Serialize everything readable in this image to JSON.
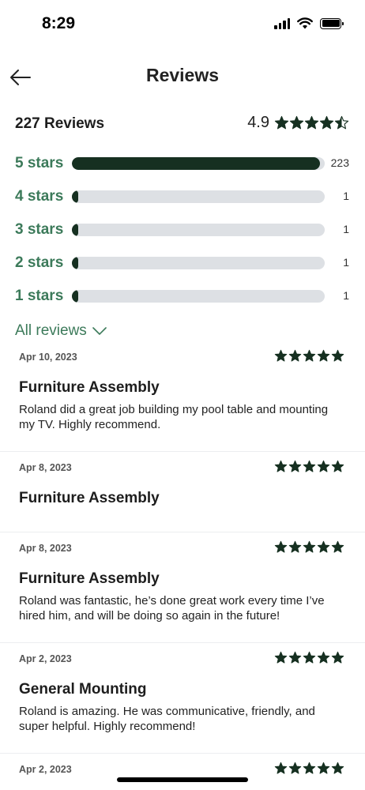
{
  "status": {
    "time": "8:29"
  },
  "nav": {
    "title": "Reviews"
  },
  "summary": {
    "count_label": "227 Reviews",
    "average": "4.9",
    "average_stars": 4.9
  },
  "distribution": [
    {
      "label": "5 stars",
      "count": "223",
      "fraction": 0.98
    },
    {
      "label": "4 stars",
      "count": "1",
      "fraction": 0.004
    },
    {
      "label": "3 stars",
      "count": "1",
      "fraction": 0.004
    },
    {
      "label": "2 stars",
      "count": "1",
      "fraction": 0.004
    },
    {
      "label": "1 stars",
      "count": "1",
      "fraction": 0.004
    }
  ],
  "filter": {
    "label": "All reviews"
  },
  "reviews": [
    {
      "date": "Apr 10, 2023",
      "rating": 5,
      "title": "Furniture Assembly",
      "body": "Roland did a great job building my pool table and mounting my TV. Highly recommend."
    },
    {
      "date": "Apr 8, 2023",
      "rating": 5,
      "title": "Furniture Assembly",
      "body": ""
    },
    {
      "date": "Apr 8, 2023",
      "rating": 5,
      "title": "Furniture Assembly",
      "body": "Roland was fantastic, he’s done great work every time I’ve hired him, and will be doing so again in the future!"
    },
    {
      "date": "Apr 2, 2023",
      "rating": 5,
      "title": "General Mounting",
      "body": "Roland is amazing. He was communicative, friendly, and super helpful. Highly recommend!"
    },
    {
      "date": "Apr 2, 2023",
      "rating": 5,
      "title": "",
      "body": ""
    }
  ],
  "colors": {
    "accent_green": "#3c7a5a",
    "bar_fill": "#163021",
    "bar_track": "#dde0e4",
    "star": "#163021"
  }
}
